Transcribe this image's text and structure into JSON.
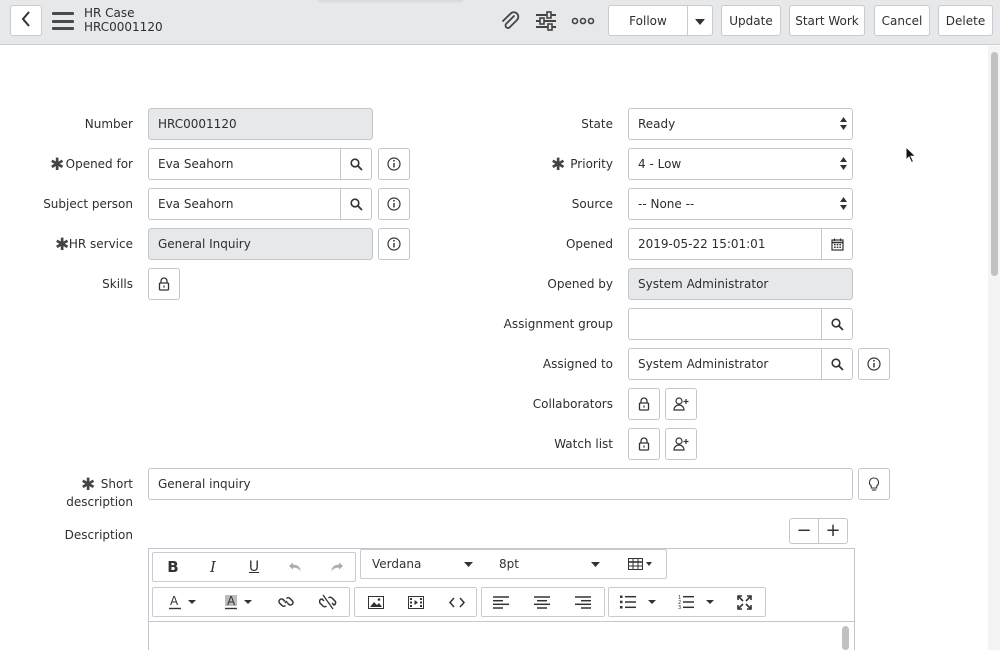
{
  "header": {
    "record_type": "HR Case",
    "record_number": "HRC0001120",
    "buttons": {
      "follow": "Follow",
      "update": "Update",
      "start_work": "Start Work",
      "cancel": "Cancel",
      "delete": "Delete"
    },
    "icons": [
      "back-icon",
      "hamburger-menu-icon",
      "paperclip-icon",
      "sliders-icon",
      "more-icon",
      "chevron-down-icon"
    ]
  },
  "form": {
    "left": {
      "number": {
        "label": "Number",
        "value": "HRC0001120"
      },
      "opened_for": {
        "label": "Opened for",
        "value": "Eva Seahorn"
      },
      "subject_person": {
        "label": "Subject person",
        "value": "Eva Seahorn"
      },
      "hr_service": {
        "label": "HR service",
        "value": "General Inquiry"
      },
      "skills": {
        "label": "Skills"
      }
    },
    "right": {
      "state": {
        "label": "State",
        "value": "Ready"
      },
      "priority": {
        "label": "Priority",
        "value": "4 - Low"
      },
      "source": {
        "label": "Source",
        "value": "-- None --"
      },
      "opened": {
        "label": "Opened",
        "value": "2019-05-22 15:01:01"
      },
      "opened_by": {
        "label": "Opened by",
        "value": "System Administrator"
      },
      "assignment_group": {
        "label": "Assignment group",
        "value": ""
      },
      "assigned_to": {
        "label": "Assigned to",
        "value": "System Administrator"
      },
      "collaborators": {
        "label": "Collaborators"
      },
      "watch_list": {
        "label": "Watch list"
      }
    },
    "short_description": {
      "label_line1": "Short",
      "label_line2": "description",
      "value": "General inquiry"
    },
    "description": {
      "label": "Description"
    },
    "required_marker": "✱"
  },
  "editor": {
    "font_family": "Verdana",
    "font_size": "8pt",
    "minus": "−",
    "plus": "+"
  },
  "colors": {
    "header_bg": "#e6e8ea",
    "readonly_bg": "#e6e8ea",
    "border": "#c3c7cb",
    "text": "#2e2e2e"
  }
}
